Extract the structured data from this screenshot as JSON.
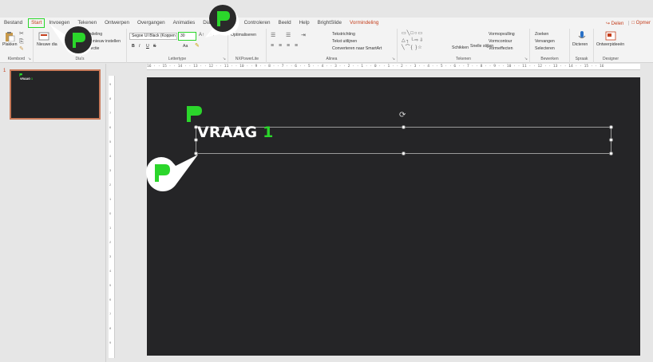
{
  "tabs": [
    {
      "label": "Bestand"
    },
    {
      "label": "Start",
      "active": true
    },
    {
      "label": "Invoegen"
    },
    {
      "label": "Tekenen"
    },
    {
      "label": "Ontwerpen"
    },
    {
      "label": "Overgangen"
    },
    {
      "label": "Animaties"
    },
    {
      "label": "Diavoorstelling"
    },
    {
      "label": "Controleren"
    },
    {
      "label": "Beeld"
    },
    {
      "label": "Help"
    },
    {
      "label": "BrightSlide"
    },
    {
      "label": "Vormindeling",
      "accent": true
    }
  ],
  "share_label": "Delen",
  "comments_label": "Opmer",
  "ribbon": {
    "clipboard": {
      "paste": "Plakken",
      "label": "Klembord"
    },
    "slides": {
      "new_slide": "Nieuwe dia",
      "layout": "Indeling",
      "reset": "Opnieuw instellen",
      "section": "Sectie",
      "label": "Dia's"
    },
    "font": {
      "family": "Segoe UI Black (Koppen",
      "size": "30",
      "bold": "B",
      "italic": "I",
      "underline": "U",
      "strike": "S",
      "case": "Aa",
      "label": "Lettertype"
    },
    "nlpower": {
      "optimize": "Optimaliseren",
      "label": "NXPowerLite"
    },
    "paragraph": {
      "direction": "Tekstrichting",
      "align": "Tekst uitlijnen",
      "smartart": "Converteren naar SmartArt",
      "label": "Alinea"
    },
    "drawing": {
      "arrange": "Schikken",
      "quick_styles": "Snelle stijlen",
      "fill": "Vormopvulling",
      "outline": "Vormcontour",
      "effects": "Vormeffecten",
      "label": "Tekenen"
    },
    "editing": {
      "find": "Zoeken",
      "replace": "Vervangen",
      "select": "Selecteren",
      "label": "Bewerken"
    },
    "voice": {
      "dictate": "Dicteren",
      "label": "Spraak"
    },
    "designer": {
      "ideas": "Ontwerpideeën",
      "label": "Designer"
    }
  },
  "ruler_text": "16 · · 15 · · 14 · · 13 · · 12 · · 11 · · 10 · · 9 · · 8 · · 7 · · 6 · · 5 · · 4 · · 3 · · 2 · · 1 · · 0 · · 1 · · 2 · · 3 · · 4 · · 5 · · 6 · · 7 · · 8 · · 9 · · 10 · · 11 · · 12 · · 13 · · 14 · · 15 · · 16",
  "vruler_ticks": [
    "9",
    "8",
    "7",
    "6",
    "5",
    "4",
    "3",
    "2",
    "1",
    "0",
    "1",
    "2",
    "3",
    "4",
    "5",
    "6",
    "7",
    "8",
    "9"
  ],
  "thumbnail": {
    "number": "1",
    "title_word": "VRAAG",
    "title_num": "1"
  },
  "slide": {
    "title_word": "VRAAG",
    "title_num": "1"
  },
  "colors": {
    "accent_green": "#2bd62b",
    "office_red": "#c43e1c",
    "slide_bg": "#252527"
  }
}
